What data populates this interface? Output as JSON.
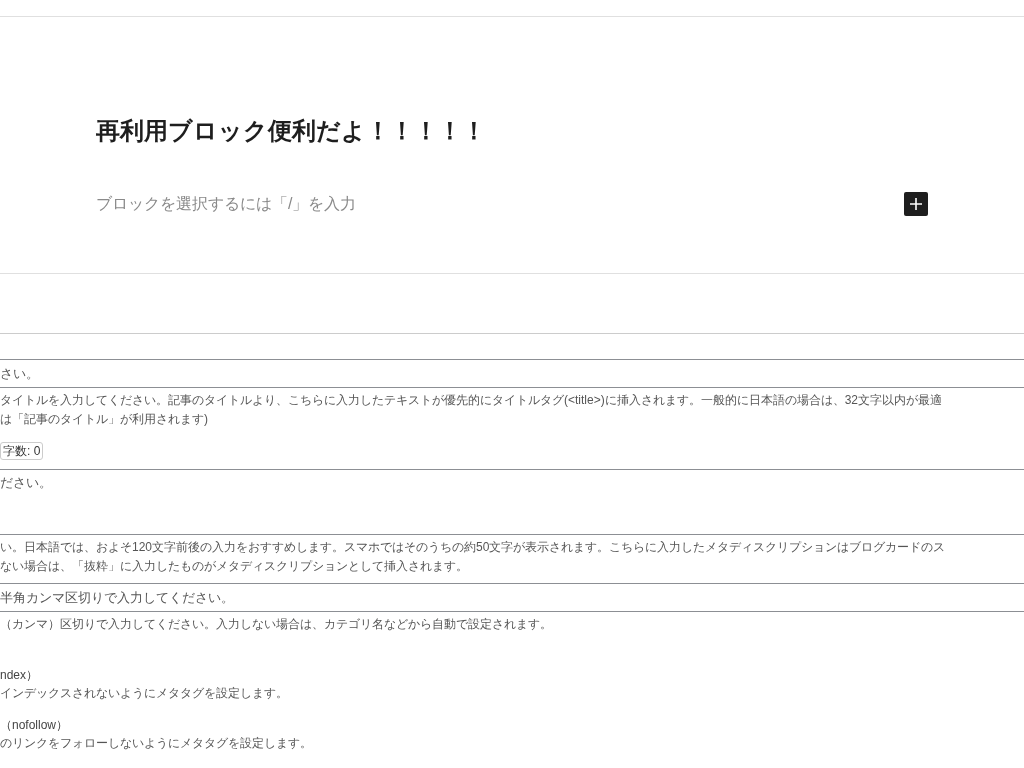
{
  "editor": {
    "title": "再利用ブロック便利だよ！！！！！",
    "placeholder": "ブロックを選択するには「/」を入力"
  },
  "seo_fields": [
    {
      "kind": "input",
      "placeholder": "さい。",
      "help": [
        "タイトルを入力してください。記事のタイトルより、こちらに入力したテキストが優先的にタイトルタグ(<title>)に挿入されます。一般的に日本語の場合は、32文字以内が最適",
        "は「記事のタイトル」が利用されます)"
      ],
      "counter": "字数: 0"
    },
    {
      "kind": "textarea",
      "placeholder": "ださい。",
      "help": [
        "い。日本語では、およそ120文字前後の入力をおすすめします。スマホではそのうちの約50文字が表示されます。こちらに入力したメタディスクリプションはブログカードのス",
        "ない場合は、「抜粋」に入力したものがメタディスクリプションとして挿入されます。"
      ]
    },
    {
      "kind": "input",
      "placeholder": "半角カンマ区切りで入力してください。",
      "help": [
        "（カンマ）区切りで入力してください。入力しない場合は、カテゴリ名などから自動で設定されます。"
      ]
    }
  ],
  "options": [
    {
      "label": "ndex）",
      "description": "インデックスされないようにメタタグを設定します。"
    },
    {
      "label": "（nofollow）",
      "description": "のリンクをフォローしないようにメタタグを設定します。"
    }
  ]
}
